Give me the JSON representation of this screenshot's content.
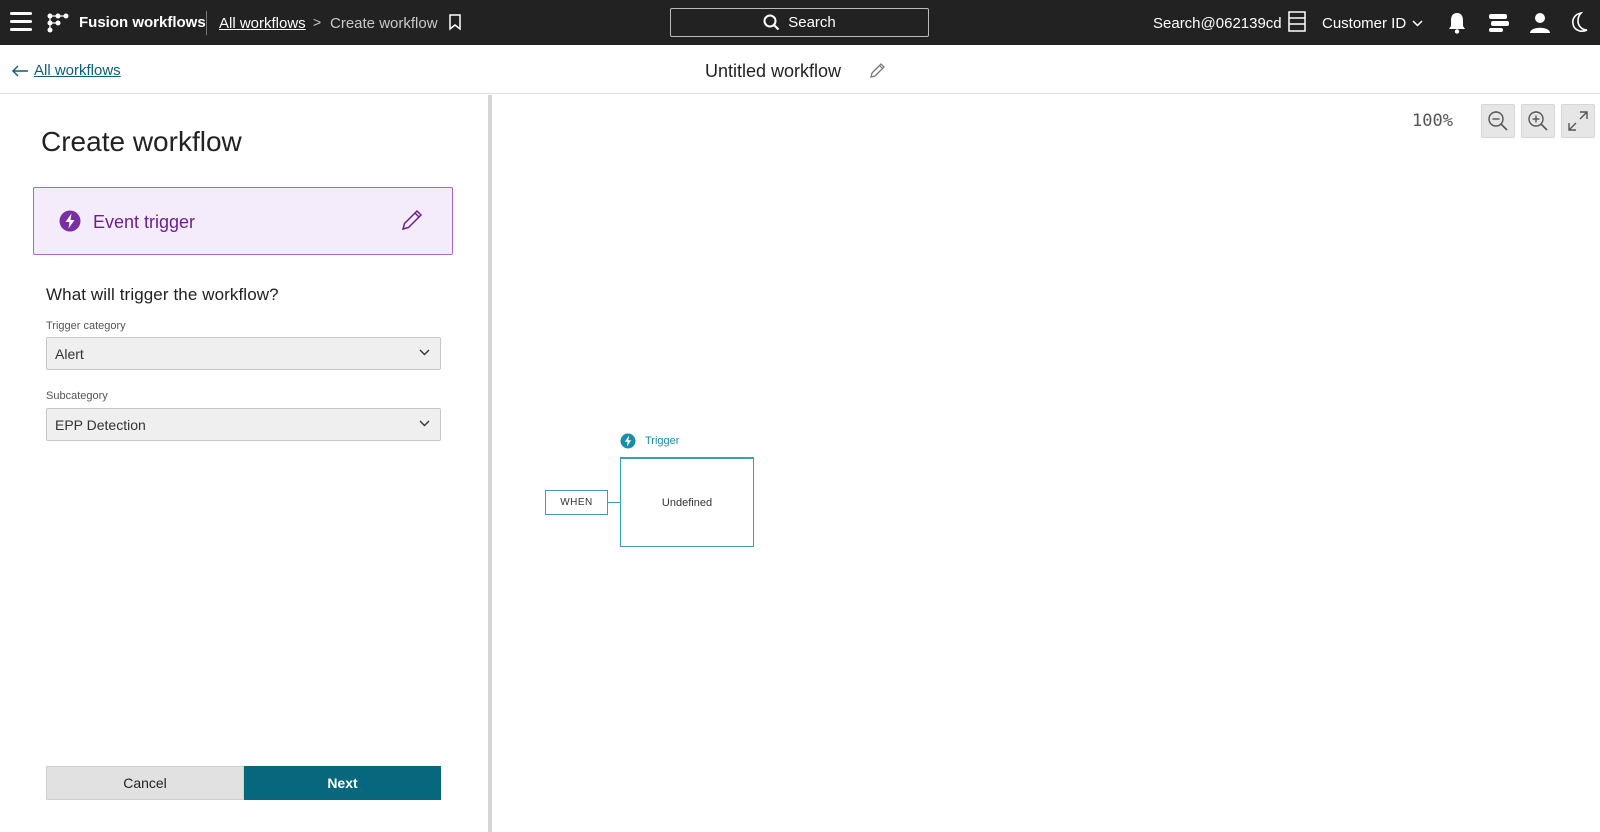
{
  "topbar": {
    "app_name": "Fusion workflows",
    "breadcrumb_link": "All workflows",
    "breadcrumb_separator": ">",
    "breadcrumb_current": "Create workflow",
    "search_label": "Search",
    "account": "Search@062139cd",
    "customer_id_label": "Customer ID"
  },
  "subheader": {
    "back_label": "All workflows",
    "workflow_title": "Untitled workflow"
  },
  "panel": {
    "title": "Create workflow",
    "trigger_card_label": "Event trigger",
    "question": "What will trigger the workflow?",
    "fields": [
      {
        "label": "Trigger category",
        "value": "Alert"
      },
      {
        "label": "Subcategory",
        "value": "EPP Detection"
      }
    ],
    "cancel_label": "Cancel",
    "next_label": "Next"
  },
  "canvas": {
    "zoom_level": "100%",
    "when_label": "WHEN",
    "node_header": "Trigger",
    "node_body": "Undefined"
  },
  "colors": {
    "topbar_bg": "#222222",
    "accent_teal": "#06677d",
    "trigger_purple": "#6b1f93",
    "node_border": "#3a9fb4"
  },
  "icons": [
    "menu-icon",
    "logo-icon",
    "bookmark-icon",
    "search-icon",
    "server-icon",
    "chevron-down-icon",
    "bell-icon",
    "messages-icon",
    "user-icon",
    "moon-icon",
    "arrow-left-icon",
    "pencil-icon",
    "lightning-icon",
    "zoom-out-icon",
    "zoom-in-icon",
    "fullscreen-icon"
  ]
}
